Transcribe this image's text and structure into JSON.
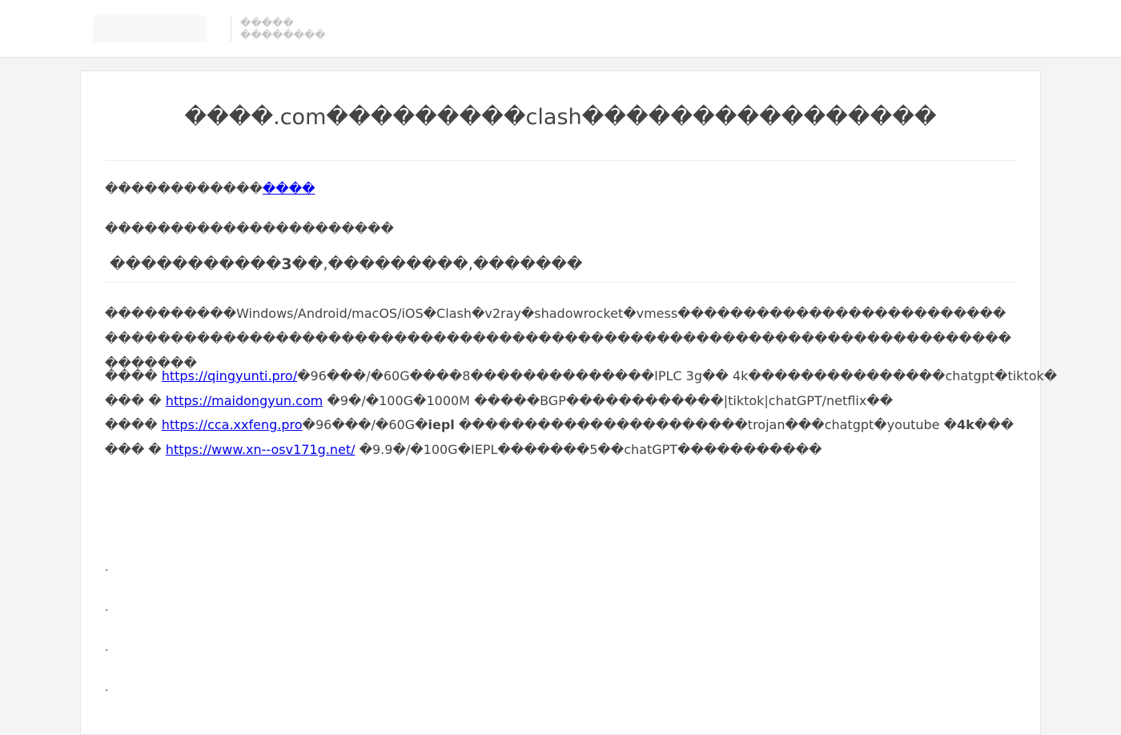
{
  "header": {
    "brand_line1": "�����",
    "brand_line2": "��������"
  },
  "article": {
    "title": "����.com���������clash����������������",
    "intro_text": "������������",
    "intro_link": "����",
    "notice": "����������������������",
    "subhead_pre": "�����������",
    "subhead_bold": "3",
    "subhead_post": "��,���������,�������",
    "paragraph": "����������Windows/Android/macOS/iOS�Clash�v2ray�shadowrocket�vmess�����������������������������������������������������������������������������������������������������",
    "airports": [
      {
        "prefix": "���� ",
        "url": "https://qingyunti.pro/",
        "desc": "�96���/�60G����8��������������IPLC 3g�� 4k���������������chatgpt�tiktok�"
      },
      {
        "prefix": "��� � ",
        "url": "https://maidongyun.com",
        "desc": " �9�/�100G�1000M �����BGP������������|tiktok|chatGPT/netflix��"
      },
      {
        "prefix": "���� ",
        "url": "https://cca.xxfeng.pro",
        "desc_pre": "�96���/�60G�",
        "desc_bold1": "iepl",
        "desc_mid": " ����������������������trojan���chatgpt�youtube �",
        "desc_bold2": "4k",
        "desc_post": "���"
      },
      {
        "prefix": "��� � ",
        "url": "https://www.xn--osv171g.net/",
        "desc": " �9.9�/�100G�IEPL�������5��chatGPT�����������"
      }
    ],
    "dots": [
      ".",
      ".",
      ".",
      "."
    ]
  }
}
